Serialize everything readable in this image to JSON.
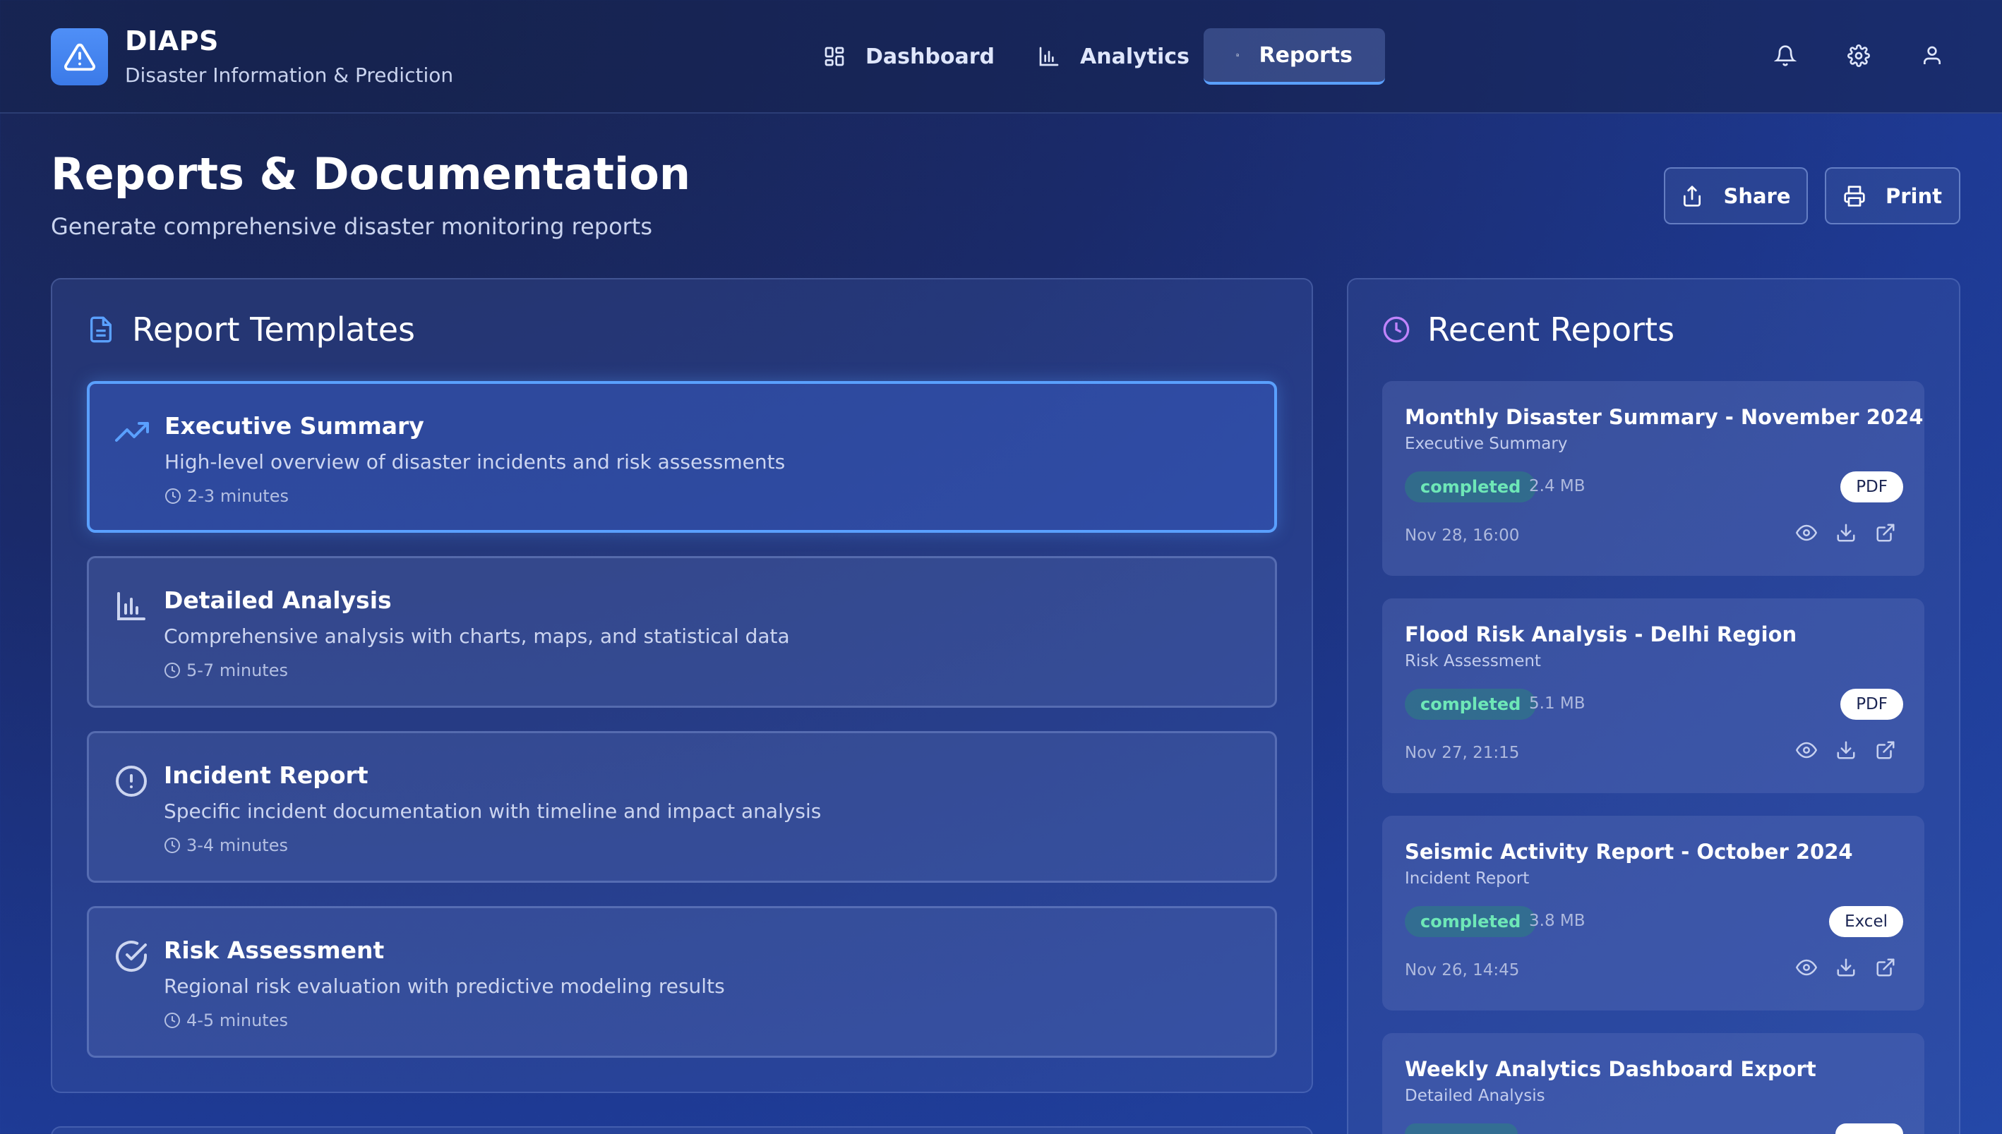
{
  "app": {
    "name": "DIAPS",
    "tagline": "Disaster Information & Prediction",
    "logo_icon": "alert-triangle-icon",
    "accent": "#3b82f6"
  },
  "nav": {
    "items": [
      {
        "label": "Dashboard",
        "icon": "grid-icon",
        "active": false
      },
      {
        "label": "Analytics",
        "icon": "bar-chart-icon",
        "active": false
      },
      {
        "label": "Reports",
        "icon": "document-icon",
        "active": true
      }
    ],
    "right_icons": [
      "bell-icon",
      "gear-icon",
      "user-icon"
    ]
  },
  "header": {
    "title": "Reports & Documentation",
    "subtitle": "Generate comprehensive disaster monitoring reports",
    "share_label": "Share",
    "print_label": "Print"
  },
  "templates": {
    "title": "Report Templates",
    "items": [
      {
        "title": "Executive Summary",
        "description": "High-level overview of disaster incidents and risk assessments",
        "duration": "2-3 minutes",
        "icon": "trending-up-icon",
        "selected": true
      },
      {
        "title": "Detailed Analysis",
        "description": "Comprehensive analysis with charts, maps, and statistical data",
        "duration": "5-7 minutes",
        "icon": "bar-chart-icon",
        "selected": false
      },
      {
        "title": "Incident Report",
        "description": "Specific incident documentation with timeline and impact analysis",
        "duration": "3-4 minutes",
        "icon": "alert-circle-icon",
        "selected": false
      },
      {
        "title": "Risk Assessment",
        "description": "Regional risk evaluation with predictive modeling results",
        "duration": "4-5 minutes",
        "icon": "check-circle-icon",
        "selected": false
      }
    ]
  },
  "recent": {
    "title": "Recent Reports",
    "items": [
      {
        "title": "Monthly Disaster Summary - November 2024",
        "type": "Executive Summary",
        "status": "completed",
        "size": "2.4 MB",
        "format": "PDF",
        "date": "Nov 28, 16:00"
      },
      {
        "title": "Flood Risk Analysis - Delhi Region",
        "type": "Risk Assessment",
        "status": "completed",
        "size": "5.1 MB",
        "format": "PDF",
        "date": "Nov 27, 21:15"
      },
      {
        "title": "Seismic Activity Report - October 2024",
        "type": "Incident Report",
        "status": "completed",
        "size": "3.8 MB",
        "format": "Excel",
        "date": "Nov 26, 14:45"
      },
      {
        "title": "Weekly Analytics Dashboard Export",
        "type": "Detailed Analysis",
        "status": "",
        "size": "",
        "format": "",
        "date": ""
      }
    ]
  }
}
